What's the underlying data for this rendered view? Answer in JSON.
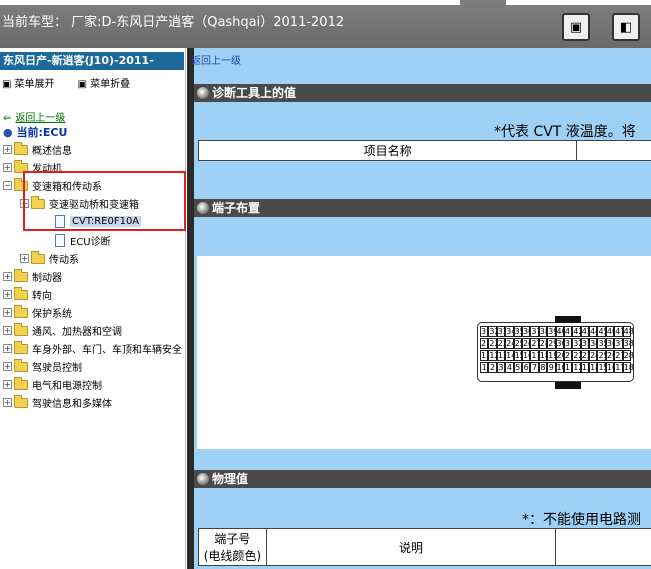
{
  "header": {
    "vehicle_label": "当前车型： 厂家:D-东风日产逍客（Qashqai）2011-2012",
    "btn_single": "▣",
    "btn_split": "◧"
  },
  "sidebar": {
    "model_title": "东风日产-新逍客(J10)-2011-",
    "expand_label": "菜单展开",
    "collapse_label": "菜单折叠",
    "back_label": "返回上一级",
    "current_label": "当前:ECU",
    "tree": [
      {
        "label": "概述信息",
        "level": 0
      },
      {
        "label": "发动机",
        "level": 0
      },
      {
        "label": "变速箱和传动系",
        "level": 0
      },
      {
        "label": "变速驱动桥和变速箱",
        "level": 1
      },
      {
        "label": "CVT:RE0F10A",
        "level": 2
      },
      {
        "label": "ECU诊断",
        "level": 2
      },
      {
        "label": "传动系",
        "level": 1
      },
      {
        "label": "制动器",
        "level": 0
      },
      {
        "label": "转向",
        "level": 0
      },
      {
        "label": "保护系统",
        "level": 0
      },
      {
        "label": "通风、加热器和空调",
        "level": 0
      },
      {
        "label": "车身外部、车门、车顶和车辆安全",
        "level": 0
      },
      {
        "label": "驾驶员控制",
        "level": 0
      },
      {
        "label": "电气和电源控制",
        "level": 0
      },
      {
        "label": "驾驶信息和多媒体",
        "level": 0
      }
    ]
  },
  "main": {
    "top_link": "返回上一级",
    "section1_title": "诊断工具上的值",
    "section1_note": "*代表 CVT 液温度。将",
    "section1_col1": "项目名称",
    "section2_title": "端子布置",
    "connector_pins_row1": [
      "31",
      "32",
      "33",
      "34",
      "35",
      "36",
      "37",
      "38",
      "39",
      "40",
      "41",
      "42",
      "43",
      "44",
      "45",
      "46",
      "47",
      "48"
    ],
    "connector_pins_row2": [
      "21",
      "22",
      "23",
      "24",
      "25",
      "26",
      "27",
      "28",
      "29",
      "30",
      "31",
      "32",
      "33",
      "34",
      "35",
      "36",
      "37",
      "38"
    ],
    "connector_pins_row3": [
      "11",
      "12",
      "13",
      "14",
      "15",
      "16",
      "17",
      "18",
      "19",
      "20",
      "21",
      "22",
      "23",
      "24",
      "25",
      "26",
      "27",
      "28"
    ],
    "connector_pins_row4": [
      "1",
      "2",
      "3",
      "4",
      "5",
      "6",
      "7",
      "8",
      "9",
      "10",
      "11",
      "12",
      "13",
      "14",
      "15",
      "16",
      "17",
      "18"
    ],
    "section3_title": "物理值",
    "section3_note": "*：不能使用电路测",
    "table3_col1": "端子号\n(电线颜色)",
    "table3_col2": "说明"
  },
  "colors": {
    "accent": "#1c6a9c",
    "main_bg": "#9fd0f5",
    "section_header_bg": "#4a4a4a",
    "highlight_box": "#e02020"
  }
}
